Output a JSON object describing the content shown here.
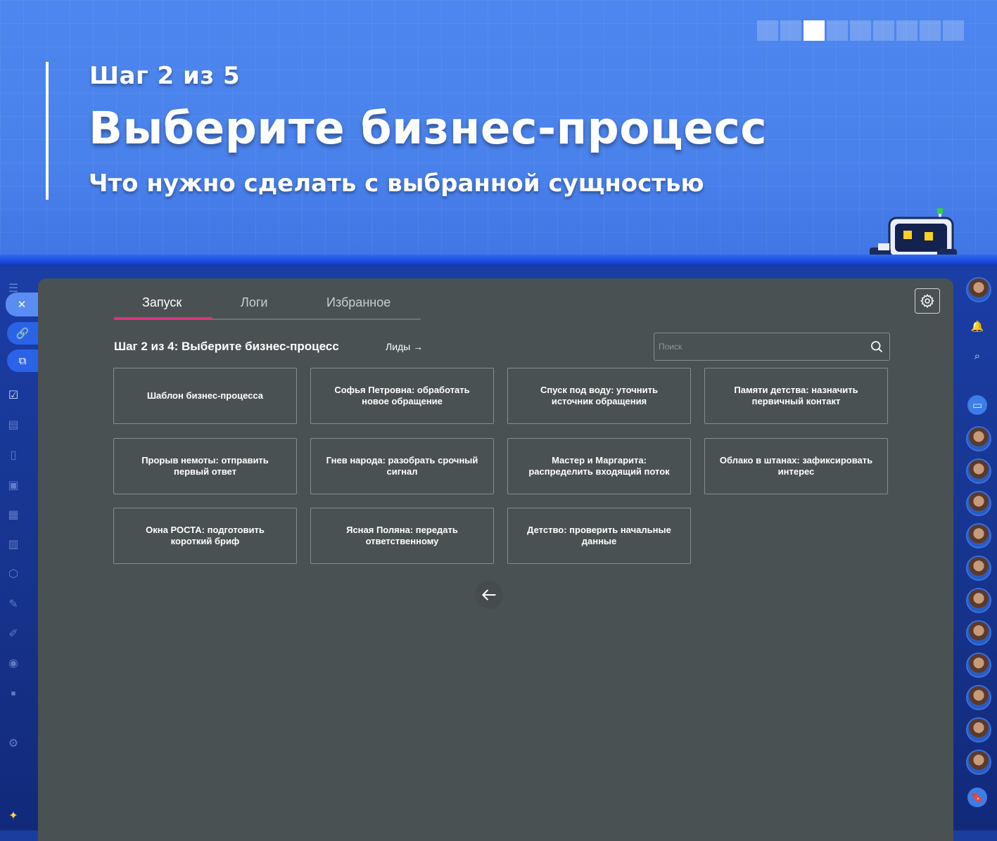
{
  "banner": {
    "step_label": "Шаг 2 из 5",
    "title": "Выберите бизнес-процесс",
    "subtitle": "Что нужно сделать с выбранной сущностью",
    "progress_total": 9,
    "progress_active_index": 2
  },
  "tabs": [
    {
      "label": "Запуск",
      "active": true
    },
    {
      "label": "Логи",
      "active": false
    },
    {
      "label": "Избранное",
      "active": false
    }
  ],
  "step_heading": "Шаг 2 из 4: Выберите бизнес-процесс",
  "entity_link": "Лиды →",
  "search": {
    "placeholder": "Поиск",
    "value": ""
  },
  "processes": [
    "Шаблон бизнес-процесса",
    "Софья Петровна: обработать новое обращение",
    "Спуск под воду: уточнить источник обращения",
    "Памяти детства: назначить первичный контакт",
    "Прорыв немоты: отправить первый ответ",
    "Гнев народа: разобрать срочный сигнал",
    "Мастер и Маргарита: распределить входящий поток",
    "Облако в штанах: зафиксировать интерес",
    "Окна РОСТА: подготовить короткий бриф",
    "Ясная Поляна: передать ответственному",
    "Детство: проверить начальные данные"
  ],
  "icons": {
    "settings": "gear-icon",
    "search": "search-icon",
    "back": "arrow-left-icon"
  },
  "colors": {
    "panel_bg": "#4a5152",
    "tab_accent": "#d8337f",
    "banner_blue": "#4a82ec"
  }
}
